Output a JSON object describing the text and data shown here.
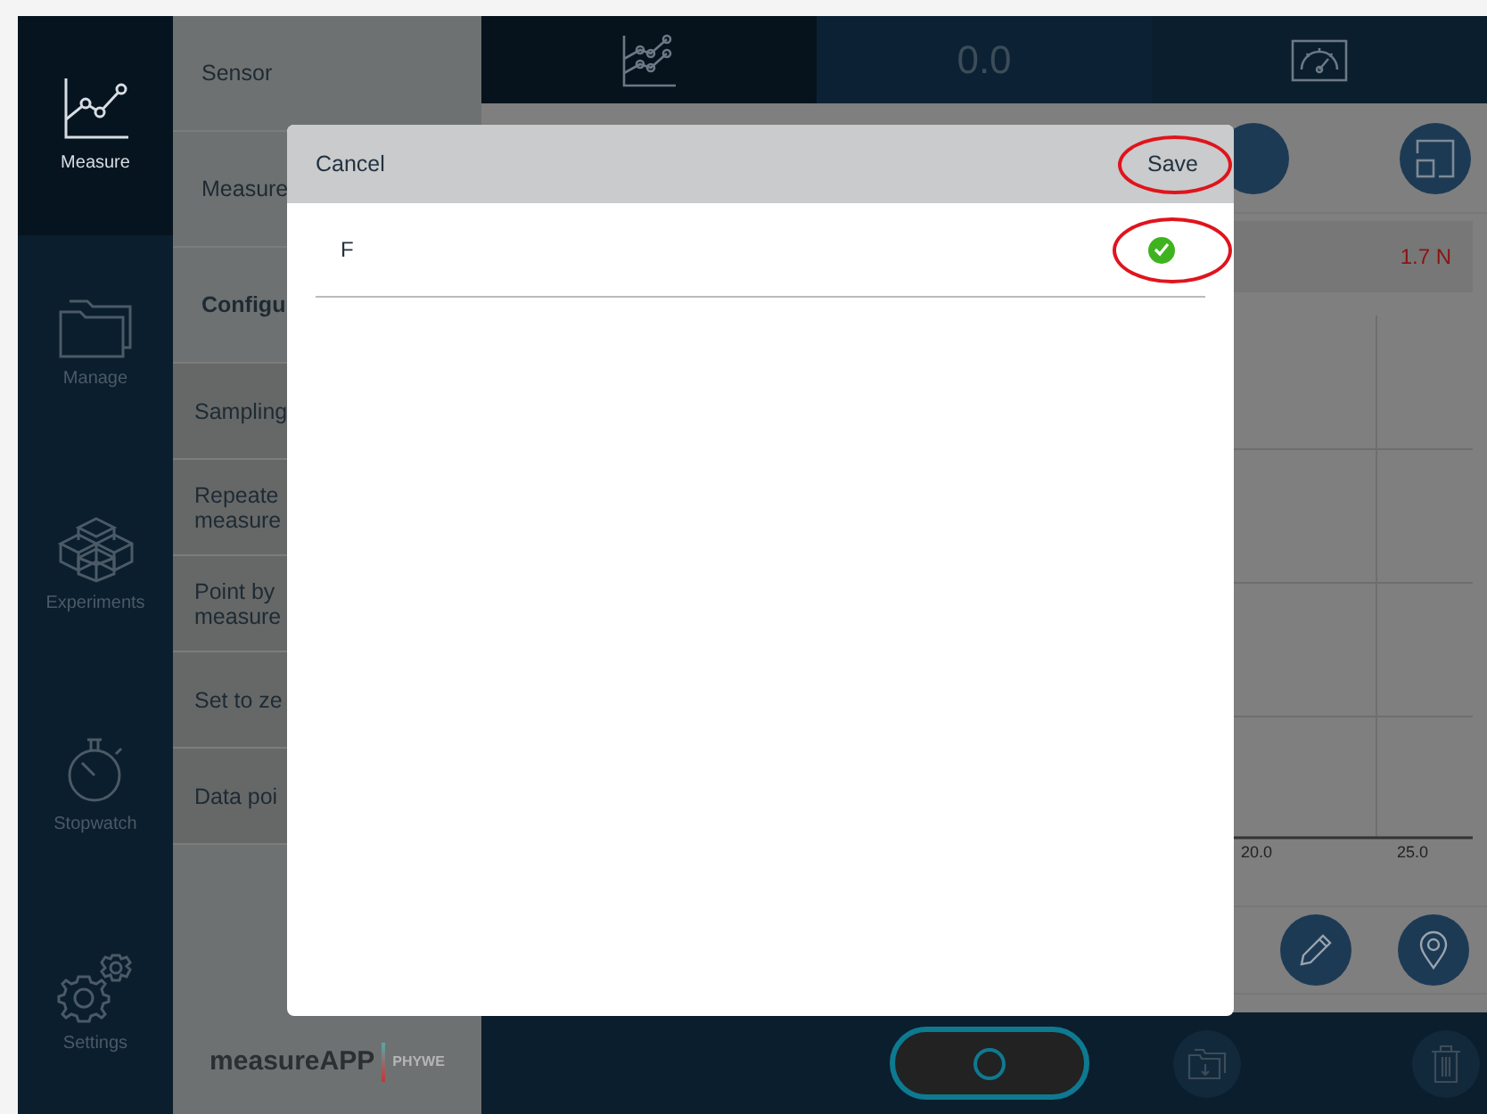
{
  "nav": [
    {
      "label": "Measure",
      "selected": true
    },
    {
      "label": "Manage",
      "selected": false
    },
    {
      "label": "Experiments",
      "selected": false
    },
    {
      "label": "Stopwatch",
      "selected": false
    },
    {
      "label": "Settings",
      "selected": false
    }
  ],
  "settings_panel": {
    "items": [
      {
        "lines": [
          "Sensor"
        ],
        "kind": "top"
      },
      {
        "lines": [
          "Measure"
        ],
        "kind": "top"
      },
      {
        "lines": [
          "Configu"
        ],
        "kind": "heading"
      },
      {
        "lines": [
          "Sampling"
        ],
        "kind": "option"
      },
      {
        "lines": [
          "Repeate",
          "measure"
        ],
        "kind": "option"
      },
      {
        "lines": [
          "Point by",
          "measure"
        ],
        "kind": "option"
      },
      {
        "lines": [
          "Set to ze"
        ],
        "kind": "option"
      },
      {
        "lines": [
          "Data poi"
        ],
        "kind": "option"
      }
    ],
    "logo": {
      "name": "measureAPP",
      "brand": "PHYWE"
    }
  },
  "view_tabs": [
    {
      "kind": "graph",
      "selected": true
    },
    {
      "kind": "digital",
      "label": "0.0",
      "selected": false
    },
    {
      "kind": "gauge",
      "selected": false
    }
  ],
  "reading": "1.7 N",
  "chart": {
    "x_ticks": [
      "20.0",
      "25.0"
    ]
  },
  "dialog": {
    "cancel": "Cancel",
    "save": "Save",
    "save_circled": true,
    "items": [
      {
        "label": "F",
        "checked": true,
        "circled": true
      }
    ]
  }
}
